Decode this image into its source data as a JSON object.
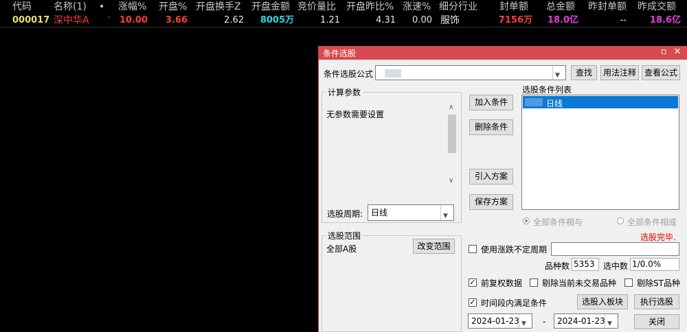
{
  "quote": {
    "headers": [
      "代码",
      "名称(1)",
      "•",
      "涨幅%",
      "开盘%",
      "开盘换手Z",
      "开盘金额",
      "竞价量比",
      "开盘昨比%",
      "涨速%",
      "细分行业",
      "封单额",
      "总金额",
      "昨封单额",
      "昨成交额"
    ],
    "row": {
      "code": "000017",
      "name": "深中华A",
      "mark": "'",
      "change_pct": "10.00",
      "open_pct": "3.66",
      "open_turnover": "2.62",
      "open_amount": "8005万",
      "auction_ratio": "1.21",
      "open_prev_ratio": "4.31",
      "speed": "0.00",
      "industry": "服饰",
      "seal_amount": "7156万",
      "total_amount": "18.0亿",
      "prev_seal": "--",
      "prev_volume": "18.6亿"
    },
    "colors": {
      "yellow": "#e8e070",
      "red": "#ff3c3c",
      "cyan": "#28d8e8",
      "white": "#e8e8e8",
      "magenta": "#e040e0"
    }
  },
  "dialog": {
    "title": "条件选股",
    "formula_label": "条件选股公式",
    "buttons": {
      "find": "查找",
      "usage": "用法注释",
      "view_formula": "查看公式",
      "add": "加入条件",
      "remove": "删除条件",
      "import": "引入方案",
      "save": "保存方案",
      "change_range": "改变范围",
      "to_block": "选股入板块",
      "execute": "执行选股",
      "close": "关闭"
    },
    "params_group": "计算参数",
    "params_text": "无参数需要设置",
    "period_label": "选股周期:",
    "period_value": "日线",
    "list_label": "选股条件列表",
    "list_items": [
      "日线"
    ],
    "radio_and": "全部条件相与",
    "radio_or": "全部条件相或",
    "status": "选股完毕.",
    "range_group": "选股范围",
    "range_value": "全部A股",
    "use_period": "使用涨跌不定周期",
    "count_label": "品种数",
    "count_value": "5353",
    "hit_label": "选中数",
    "hit_value": "1/0.0%",
    "adj_data": "前复权数据",
    "exclude_no_trade": "剔除当前未交易品种",
    "exclude_st": "剔除ST品种",
    "time_range": "时间段内满足条件",
    "date_from": "2024-01-23",
    "date_to": "2024-01-23",
    "dash": "-",
    "colors": {
      "title_bar": "#d84a4f",
      "selection": "#0a78d7",
      "status_red": "#e00000"
    }
  }
}
